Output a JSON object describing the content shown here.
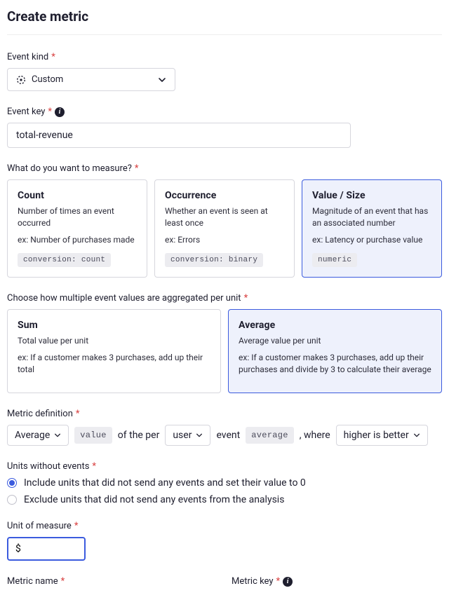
{
  "page": {
    "title": "Create metric"
  },
  "eventKind": {
    "label": "Event kind",
    "value": "Custom"
  },
  "eventKey": {
    "label": "Event key",
    "value": "total-revenue"
  },
  "measure": {
    "label": "What do you want to measure?",
    "options": [
      {
        "title": "Count",
        "sub": "Number of times an event occurred",
        "ex": "ex: Number of purchases made",
        "tag": "conversion: count",
        "selected": false
      },
      {
        "title": "Occurrence",
        "sub": "Whether an event is seen at least once",
        "ex": "ex: Errors",
        "tag": "conversion: binary",
        "selected": false
      },
      {
        "title": "Value / Size",
        "sub": "Magnitude of an event that has an associated number",
        "ex": "ex: Latency or purchase value",
        "tag": "numeric",
        "selected": true
      }
    ]
  },
  "aggregate": {
    "label": "Choose how multiple event values are aggregated per unit",
    "options": [
      {
        "title": "Sum",
        "sub": "Total value per unit",
        "ex": "ex: If a customer makes 3 purchases, add up their total",
        "selected": false
      },
      {
        "title": "Average",
        "sub": "Average value per unit",
        "ex": "ex: If a customer makes 3 purchases, add up their purchases and divide by 3 to calculate their average",
        "selected": true
      }
    ]
  },
  "definition": {
    "label": "Metric definition",
    "agg": "Average",
    "valueToken": "value",
    "text1": "of the per",
    "unit": "user",
    "text2": "event",
    "avgToken": "average",
    "text3": ", where",
    "direction": "higher is better"
  },
  "unitsWithout": {
    "label": "Units without events",
    "opt1": "Include units that did not send any events and set their value to 0",
    "opt2": "Exclude units that did not send any events from the analysis",
    "selected": 0
  },
  "unitOfMeasure": {
    "label": "Unit of measure",
    "value": "$"
  },
  "metricName": {
    "label": "Metric name"
  },
  "metricKey": {
    "label": "Metric key"
  }
}
